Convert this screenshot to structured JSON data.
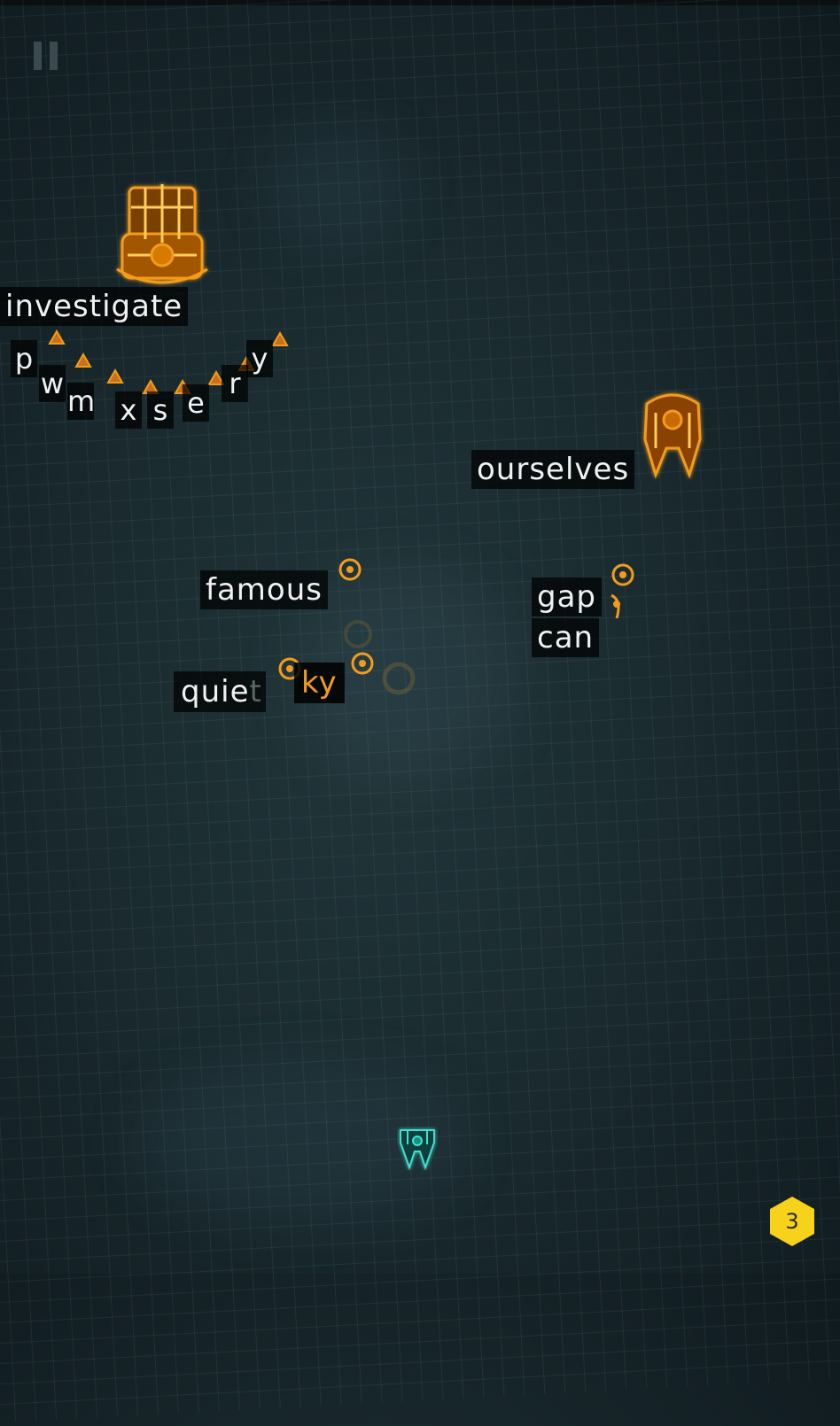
{
  "hud": {
    "pause_icon": "pause-icon",
    "level_badge": "3"
  },
  "enemies": {
    "boss_word": "investigate",
    "chain_letters": [
      "p",
      "w",
      "m",
      "x",
      "s",
      "e",
      "r",
      "y"
    ],
    "right_ship_word": "ourselves",
    "mine_words": [
      "famous",
      "gap",
      "can"
    ],
    "targeted_word": {
      "untyped_part": "quie",
      "faded_part": "t",
      "typed_text": "ky"
    }
  },
  "colors": {
    "enemy_orange": "#f39c1a",
    "player_cyan": "#3fe0d0",
    "badge_yellow": "#f7d21a"
  }
}
